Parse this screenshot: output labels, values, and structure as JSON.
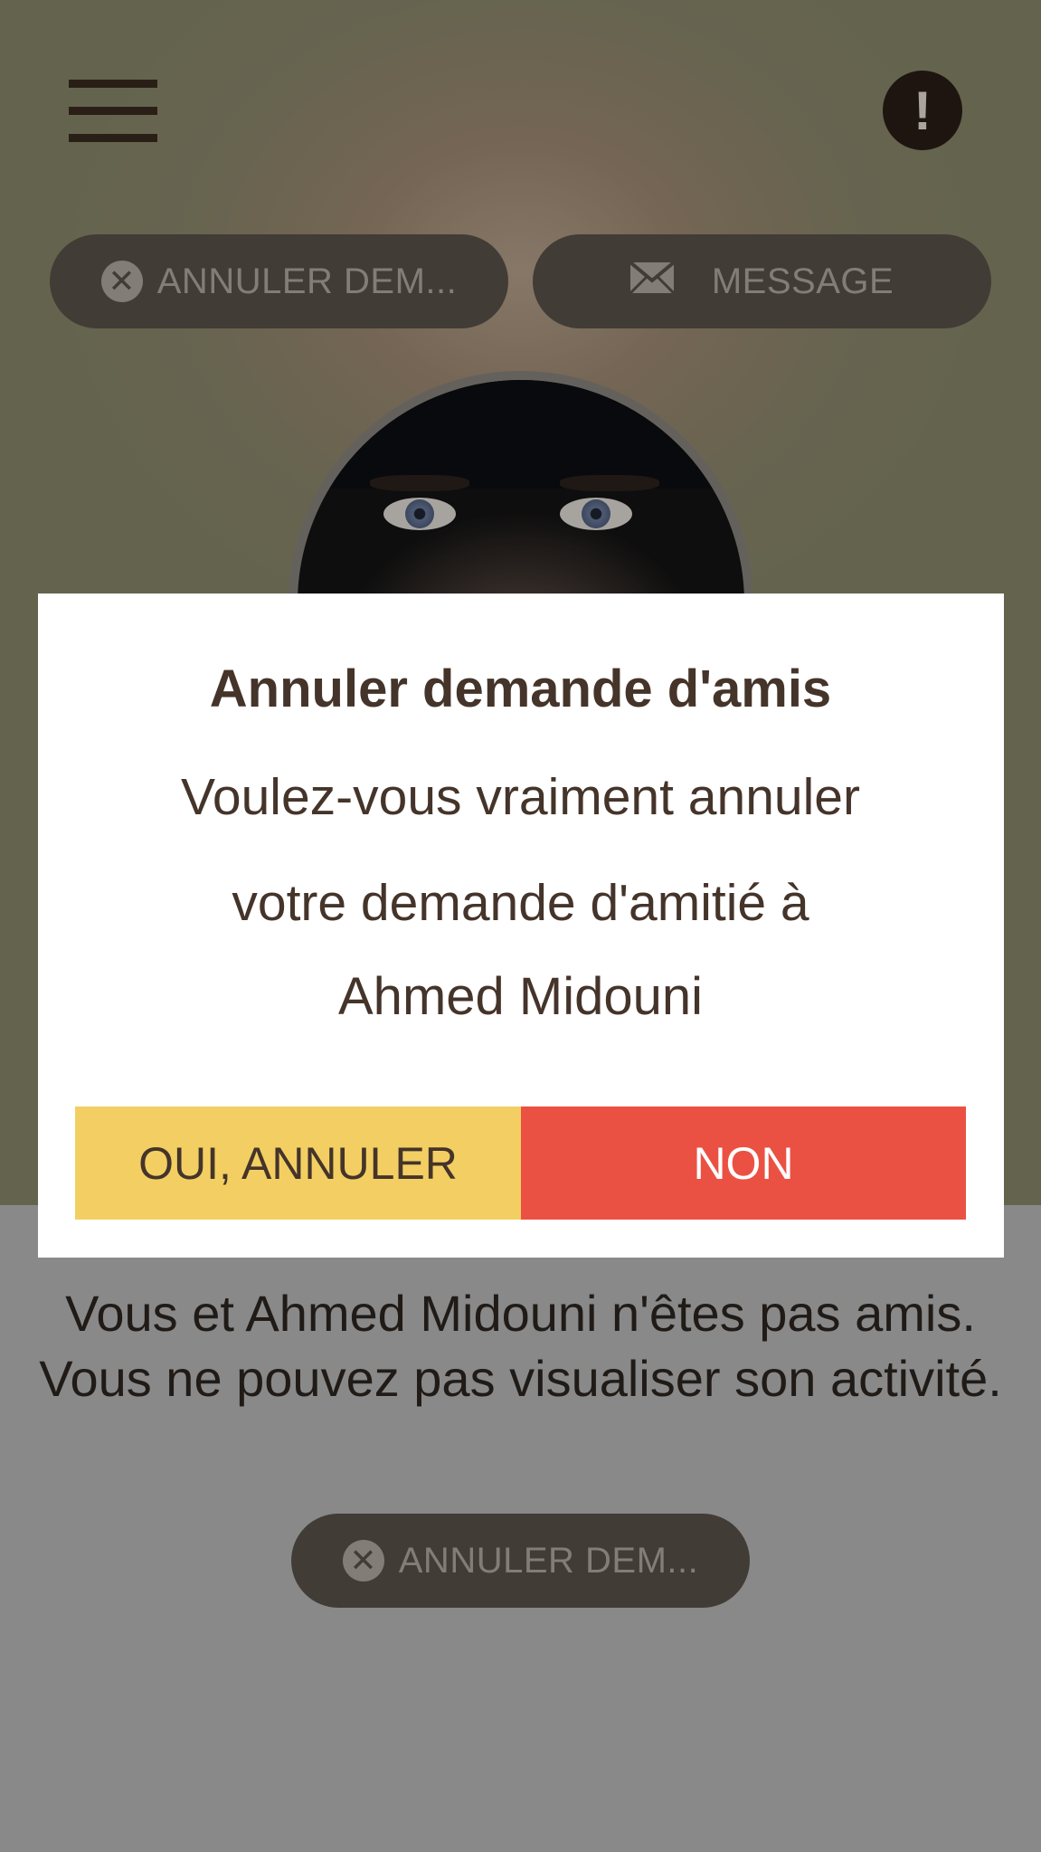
{
  "header": {
    "menu_icon": "hamburger-menu-icon",
    "alert_icon": "exclamation-icon",
    "alert_symbol": "!"
  },
  "actions": {
    "cancel_request_label": "ANNULER DEM...",
    "cancel_icon_symbol": "✕",
    "message_label": "MESSAGE"
  },
  "profile": {
    "status_text": "Vous et Ahmed Midouni n'êtes pas amis. Vous ne pouvez pas visualiser son activité.",
    "cancel_request_label": "ANNULER DEM..."
  },
  "dialog": {
    "title": "Annuler demande d'amis",
    "line1": "Voulez-vous vraiment annuler",
    "line2": "votre demande d'amitié à",
    "name": "Ahmed Midouni",
    "confirm_label": "OUI, ANNULER",
    "deny_label": "NON"
  },
  "colors": {
    "dialog_confirm": "#f3cf63",
    "dialog_deny": "#eb5143",
    "text_brown": "#45342a",
    "pill_bg": "#5b534b"
  }
}
